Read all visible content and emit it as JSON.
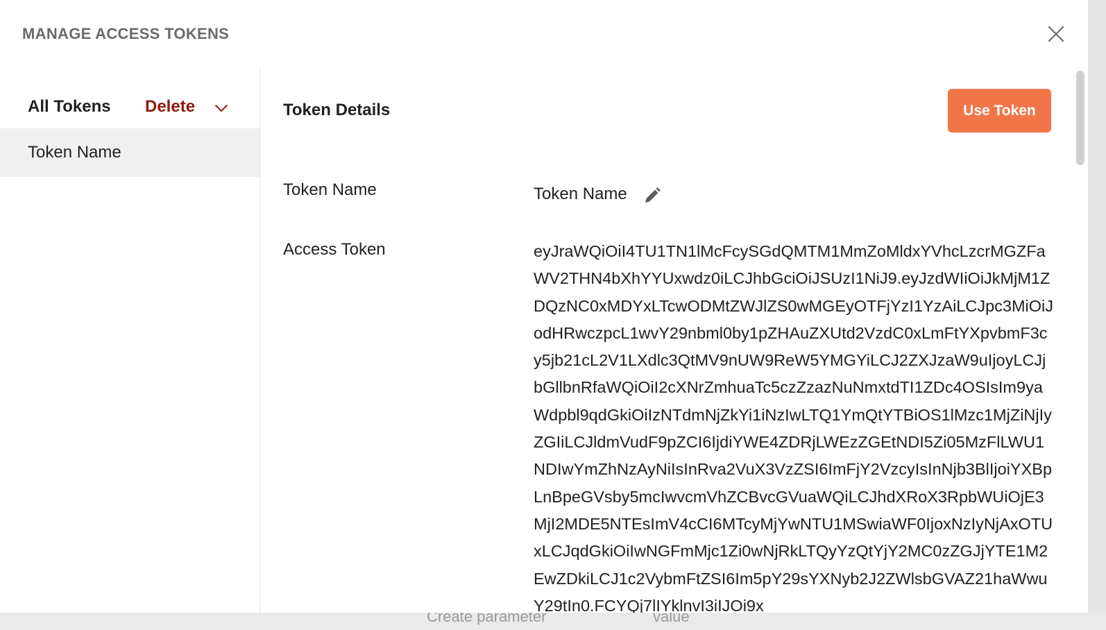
{
  "modal": {
    "title": "MANAGE ACCESS TOKENS",
    "close_icon": "close-icon"
  },
  "sidebar": {
    "header": "All Tokens",
    "delete_label": "Delete",
    "dropdown_icon": "chevron-down-icon",
    "items": [
      {
        "label": "Token Name",
        "selected": true
      }
    ]
  },
  "details": {
    "title": "Token Details",
    "use_token_label": "Use Token",
    "name_label": "Token Name",
    "name_value": "Token Name",
    "edit_icon": "pencil-icon",
    "access_token_label": "Access Token",
    "access_token_value": "eyJraWQiOiI4TU1TN1lMcFcySGdQMTM1MmZoMldxYVhcLzcrMGZFaWV2THN4bXhYYUxwdz0iLCJhbGciOiJSUzI1NiJ9.eyJzdWIiOiJkMjM1ZDQzNC0xMDYxLTcwODMtZWJlZS0wMGEyOTFjYzI1YzAiLCJpc3MiOiJodHRwczpcL1wvY29nbml0by1pZHAuZXUtd2VzdC0xLmFtYXpvbmF3cy5jb21cL2V1LXdlc3QtMV9nUW9ReW5YMGYiLCJ2ZXJzaW9uIjoyLCJjbGllbnRfaWQiOiI2cXNrZmhuaTc5czZzazNuNmxtdTI1ZDc4OSIsIm9yaWdpbl9qdGkiOiIzNTdmNjZkYi1iNzIwLTQ1YmQtYTBiOS1lMzc1MjZiNjIyZGIiLCJldmVudF9pZCI6IjdiYWE4ZDRjLWEzZGEtNDI5Zi05MzFlLWU1NDIwYmZhNzAyNiIsInRva2VuX3VzZSI6ImFjY2VzcyIsInNjb3BlIjoiYXBpLnBpeGVsby5mcIwvcmVhZCBvcGVuaWQiLCJhdXRoX3RpbWUiOjE3MjI2MDE5NTEsImV4cCI6MTcyMjYwNTU1MSwiaWF0IjoxNzIyNjAxOTUxLCJqdGkiOiIwNGFmMjc1Zi0wNjRkLTQyYzQtYjY2MC0zZGJjYTE1M2EwZDkiLCJ1c2VybmFtZSI6Im5pY29sYXNyb2J2ZWlsbGVAZ21haWwuY29tIn0.FCYQj7lIYklnvI3iIJOi9x"
  },
  "background": {
    "param_placeholder": "Create parameter",
    "value_placeholder": "value"
  }
}
